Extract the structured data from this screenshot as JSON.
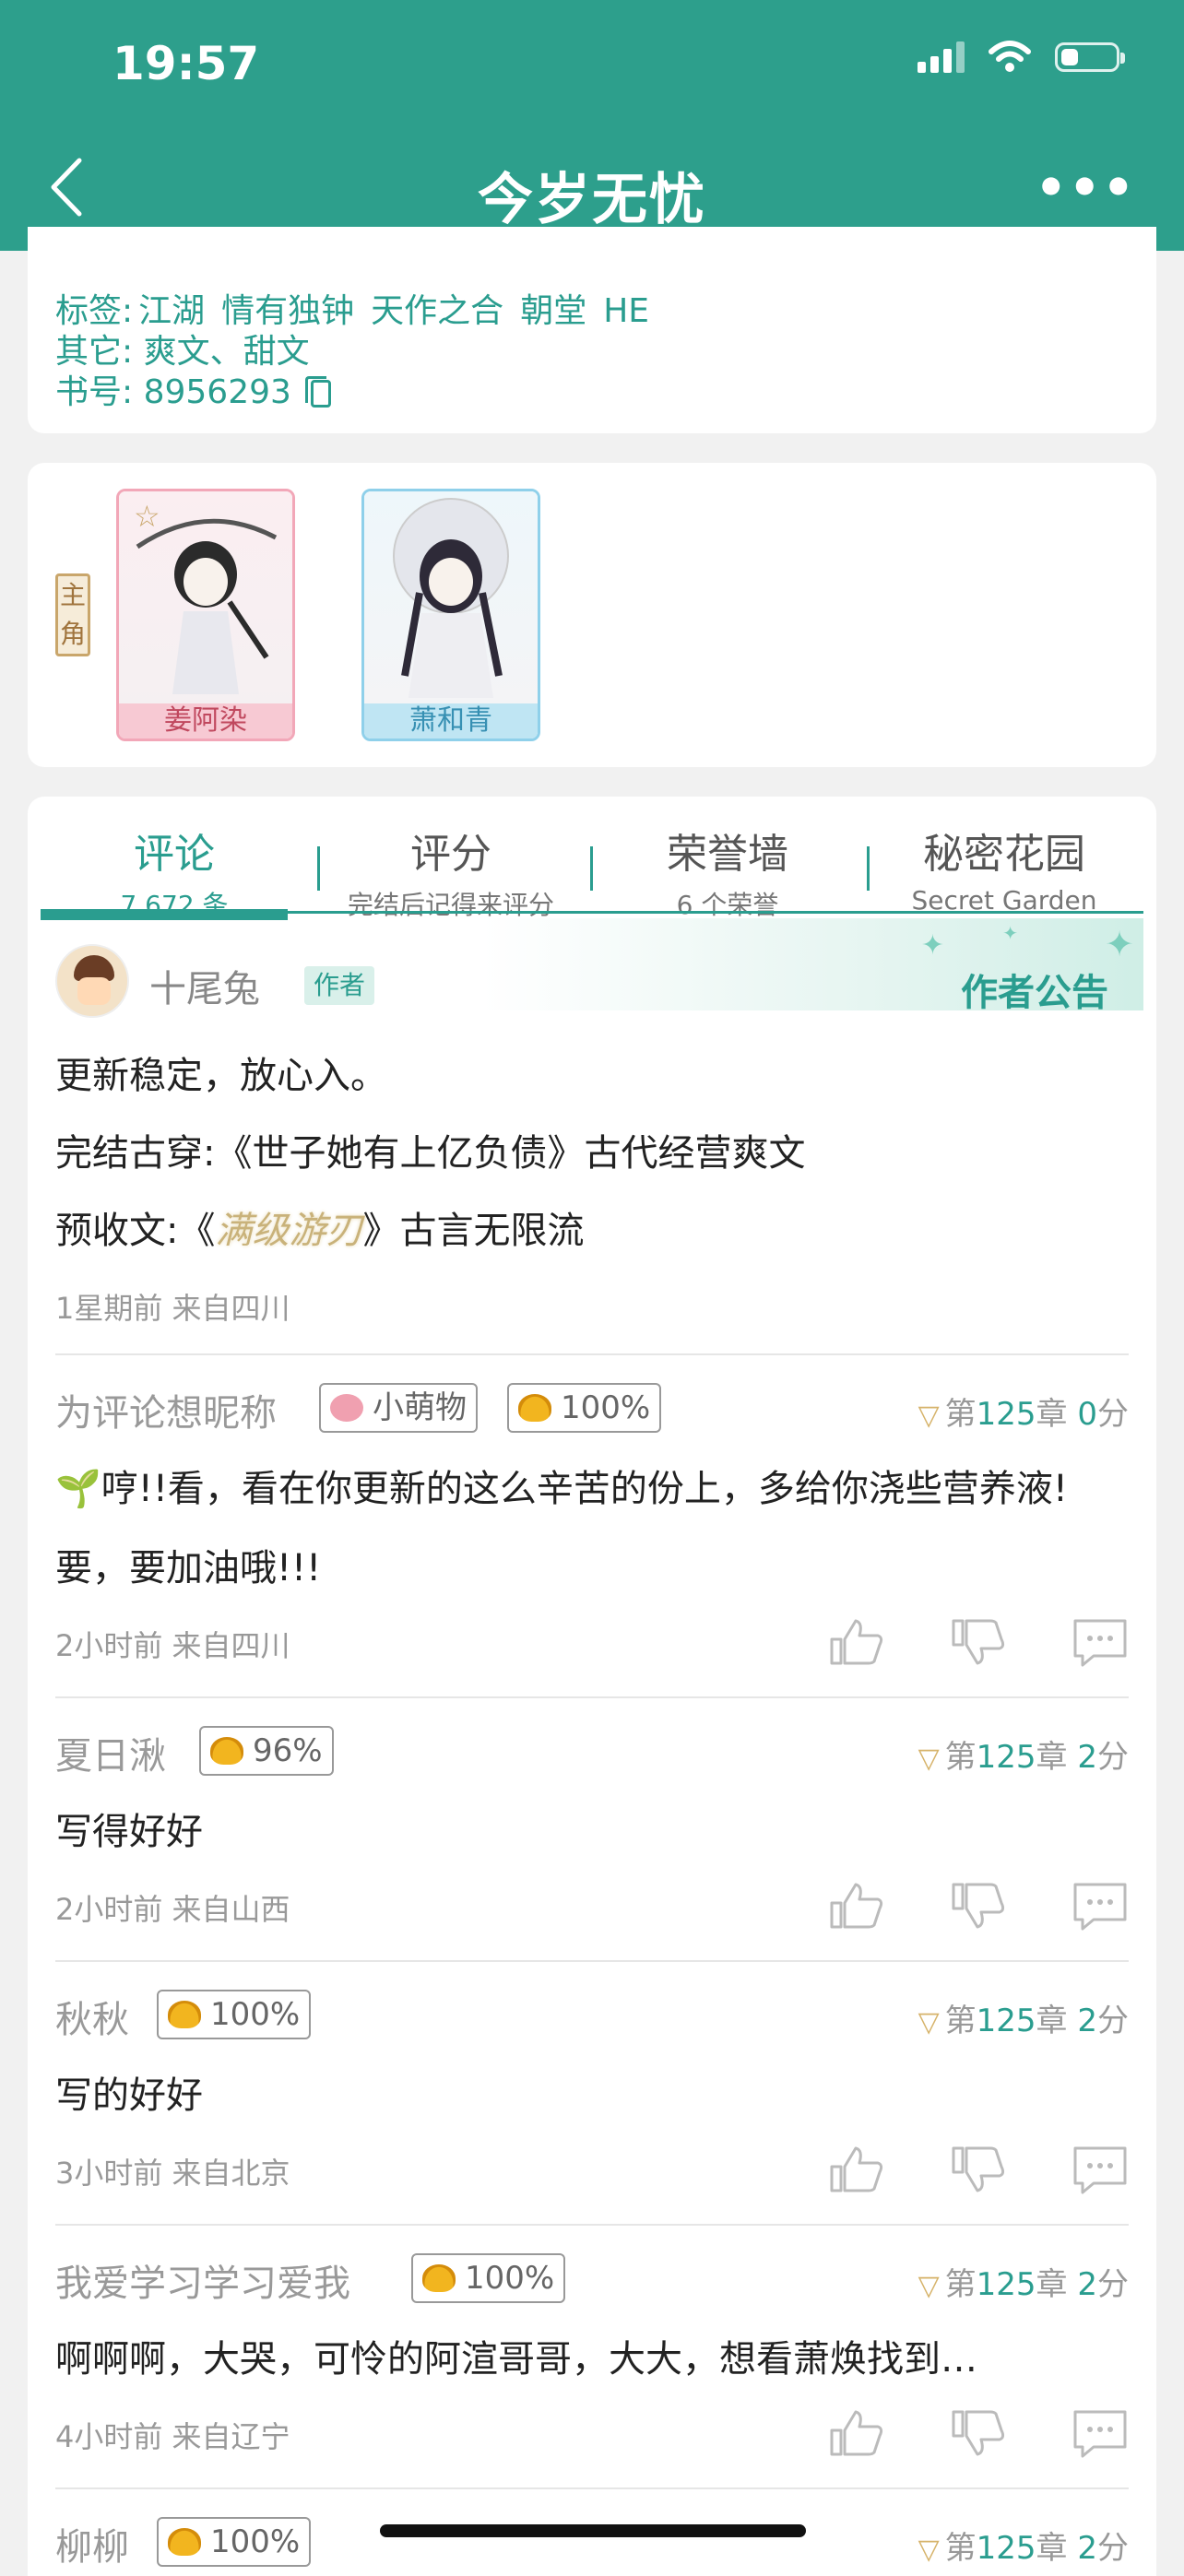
{
  "status": {
    "time": "19:57"
  },
  "nav": {
    "title": "今岁无忧",
    "back_icon": "chevron-left-icon",
    "more_icon": "more-horizontal-icon",
    "more_label": "•••"
  },
  "info": {
    "tags_label": "标签:",
    "tags": [
      "江湖",
      "情有独钟",
      "天作之合",
      "朝堂",
      "HE"
    ],
    "other_label": "其它:",
    "other": "爽文、甜文",
    "id_label": "书号:",
    "id": "8956293"
  },
  "characters": {
    "role_label": "主角",
    "items": [
      {
        "name": "姜阿染",
        "color": "#f7c9d3"
      },
      {
        "name": "萧和青",
        "color": "#bfe5f3"
      }
    ]
  },
  "tabs": [
    {
      "title": "评论",
      "sub": "7,672 条"
    },
    {
      "title": "评分",
      "sub": "完结后记得来评分"
    },
    {
      "title": "荣誉墙",
      "sub": "6 个荣誉"
    },
    {
      "title": "秘密花园",
      "sub": "Secret Garden"
    }
  ],
  "notice": {
    "author": "十尾兔",
    "author_badge": "作者",
    "title": "作者公告",
    "lines": [
      "更新稳定，放心入。",
      "完结古穿:《世子她有上亿负债》古代经营爽文"
    ],
    "line3_prefix": "预收文:《",
    "line3_title": "满级游刃",
    "line3_suffix": "》古言无限流",
    "meta": "1星期前  来自四川"
  },
  "comments": [
    {
      "name": "为评论想昵称",
      "badge1": "小萌物",
      "badge2": "100%",
      "chapter_prefix": "第",
      "chapter": "125",
      "chapter_mid": "章",
      "score": "0",
      "score_suffix": "分",
      "text": "🌱哼!!看，看在你更新的这么辛苦的份上，多给你浇些营养液!要，要加油哦!!!",
      "meta": "2小时前  来自四川"
    },
    {
      "name": "夏日湫",
      "badge2": "96%",
      "chapter_prefix": "第",
      "chapter": "125",
      "chapter_mid": "章",
      "score": "2",
      "score_suffix": "分",
      "text": "写得好好",
      "meta": "2小时前  来自山西"
    },
    {
      "name": "秋秋",
      "badge2": "100%",
      "chapter_prefix": "第",
      "chapter": "125",
      "chapter_mid": "章",
      "score": "2",
      "score_suffix": "分",
      "text": "写的好好",
      "meta": "3小时前  来自北京"
    },
    {
      "name": "我爱学习学习爱我",
      "badge2": "100%",
      "chapter_prefix": "第",
      "chapter": "125",
      "chapter_mid": "章",
      "score": "2",
      "score_suffix": "分",
      "text": "啊啊啊，大哭，可怜的阿渲哥哥，大大，想看萧焕找到…",
      "meta": "4小时前  来自辽宁"
    },
    {
      "name": "柳柳",
      "badge2": "100%",
      "chapter_prefix": "第",
      "chapter": "125",
      "chapter_mid": "章",
      "score": "2",
      "score_suffix": "分"
    }
  ],
  "icons": {
    "like": "thumbs-up-icon",
    "dislike": "thumbs-down-icon",
    "reply": "comment-icon",
    "vip": "v-badge-icon"
  },
  "colors": {
    "accent": "#2a9d8f",
    "gold": "#d6b36a"
  }
}
